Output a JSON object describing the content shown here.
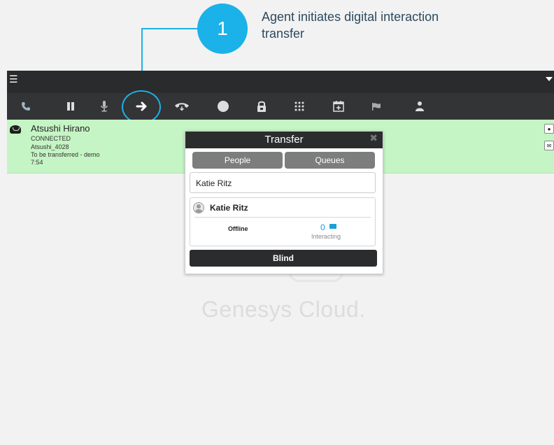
{
  "callout": {
    "number": "1",
    "text": "Agent initiates digital interaction transfer",
    "color": "#1ab2e8"
  },
  "menubar": {
    "menu_icon": "hamburger-icon",
    "caret_icon": "caret-down-icon"
  },
  "toolbar": {
    "icons": [
      "phone-icon",
      "pause-icon",
      "microphone-icon",
      "transfer-arrow-icon",
      "hangup-icon",
      "record-icon",
      "lock-icon",
      "keypad-icon",
      "schedule-icon",
      "flag-icon",
      "user-icon"
    ],
    "active_icon": "transfer-arrow-icon"
  },
  "interaction": {
    "name": "Atsushi Hirano",
    "status": "CONNECTED",
    "handle": "Atsushi_4028",
    "subject": "To be transferred - demo",
    "duration": "7:54",
    "background": "#c5f5c4"
  },
  "transfer_dialog": {
    "title": "Transfer",
    "tab_people": "People",
    "tab_queues": "Queues",
    "search_value": "Katie Ritz",
    "result": {
      "name": "Katie Ritz",
      "presence": "Offline",
      "interacting_count": "0",
      "interacting_label": "Interacting"
    },
    "blind_button": "Blind"
  },
  "watermark": {
    "text": "Genesys Cloud."
  }
}
